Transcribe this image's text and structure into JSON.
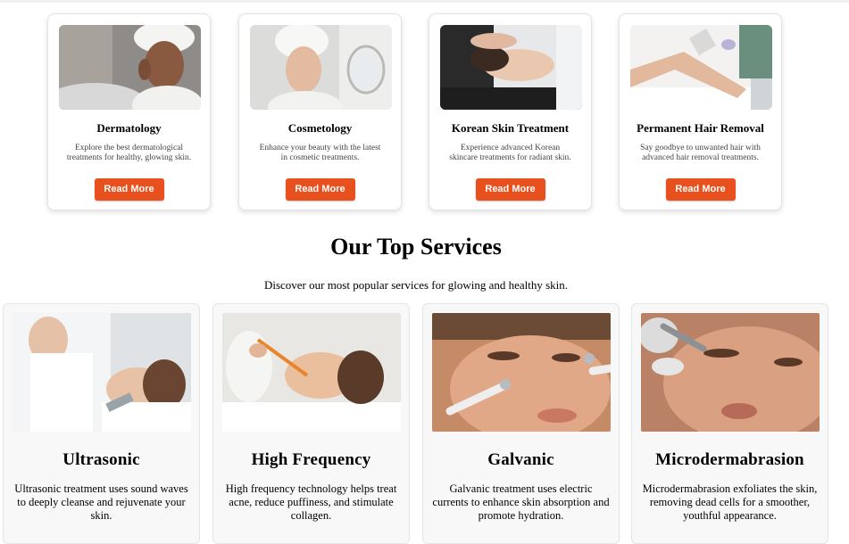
{
  "categories": [
    {
      "title": "Dermatology",
      "description": "Explore the best dermatological treatments for healthy, glowing skin.",
      "button": "Read More"
    },
    {
      "title": "Cosmetology",
      "description": "Enhance your beauty with the latest in cosmetic treatments.",
      "button": "Read More"
    },
    {
      "title": "Korean Skin Treatment",
      "description": "Experience advanced Korean skincare treatments for radiant skin.",
      "button": "Read More"
    },
    {
      "title": "Permanent Hair Removal",
      "description": "Say goodbye to unwanted hair with advanced hair removal treatments.",
      "button": "Read More"
    }
  ],
  "top_services": {
    "title": "Our Top Services",
    "subtitle": "Discover our most popular services for glowing and healthy skin.",
    "items": [
      {
        "title": "Ultrasonic",
        "description": "Ultrasonic treatment uses sound waves to deeply cleanse and rejuvenate your skin."
      },
      {
        "title": "High Frequency",
        "description": "High frequency technology helps treat acne, reduce puffiness, and stimulate collagen."
      },
      {
        "title": "Galvanic",
        "description": "Galvanic treatment uses electric currents to enhance skin absorption and promote hydration."
      },
      {
        "title": "Microdermabrasion",
        "description": "Microdermabrasion exfoliates the skin, removing dead cells for a smoother, youthful appearance."
      }
    ]
  },
  "theme": {
    "accent": "#e8501e",
    "card_border": "#e3e3e3",
    "service_card_bg": "#f8f8f8"
  }
}
